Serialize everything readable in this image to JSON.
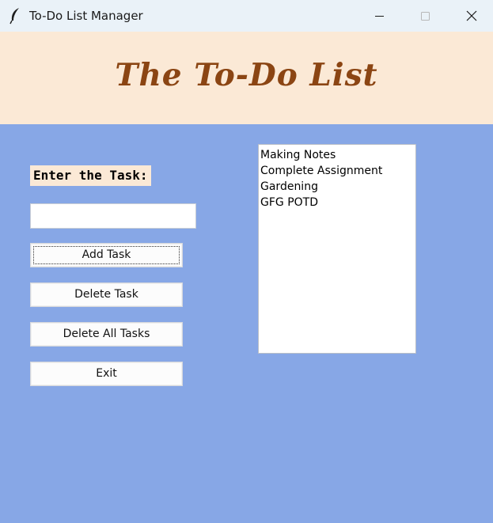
{
  "window": {
    "title": "To-Do List Manager",
    "icon": "feather-icon",
    "controls": [
      "minimize-icon",
      "maximize-icon",
      "close-icon"
    ]
  },
  "header": {
    "title": "The To-Do List"
  },
  "form": {
    "label": "Enter the Task:",
    "input_value": "",
    "buttons": {
      "add": "Add Task",
      "delete": "Delete Task",
      "delete_all": "Delete All Tasks",
      "exit": "Exit"
    }
  },
  "tasks": [
    "Making Notes",
    "Complete Assignment",
    "Gardening",
    "GFG POTD"
  ],
  "colors": {
    "background": "#87a7e6",
    "header_bg": "#fbe9d6",
    "header_text": "#8b4513",
    "titlebar_bg": "#eaf2f8"
  }
}
